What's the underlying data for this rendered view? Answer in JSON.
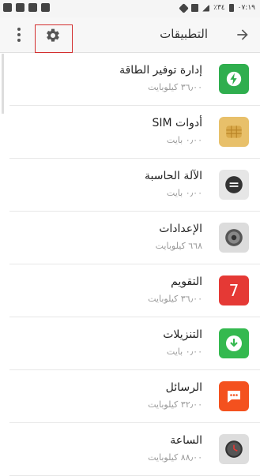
{
  "status_bar": {
    "battery": "٪٣٤",
    "time": "٠٧:١٩"
  },
  "toolbar": {
    "title": "التطبيقات",
    "menu_icon": "more-vert-icon",
    "settings_icon": "gear-icon",
    "back_icon": "arrow-right-icon"
  },
  "apps": [
    {
      "name": "إدارة توفير الطاقة",
      "size": "٣٦٫٠٠ كيلوبايت",
      "icon": "power-saver-icon",
      "color": "#2fae4e"
    },
    {
      "name": "أدوات SIM",
      "size": "٠٫٠٠ بايت",
      "icon": "sim-card-icon",
      "color": "#e8c06a"
    },
    {
      "name": "الآلة الحاسبة",
      "size": "٠٫٠٠ بايت",
      "icon": "calculator-icon",
      "color": "#e6e6e6"
    },
    {
      "name": "الإعدادات",
      "size": "٦٦٨ كيلوبايت",
      "icon": "settings-gear-icon",
      "color": "#dcdcdc"
    },
    {
      "name": "التقويم",
      "size": "٣٦٫٠٠ كيلوبايت",
      "icon": "calendar-icon",
      "color": "#e53935",
      "icon_text": "7"
    },
    {
      "name": "التنزيلات",
      "size": "٠٫٠٠ بايت",
      "icon": "download-icon",
      "color": "#34b94f"
    },
    {
      "name": "الرسائل",
      "size": "٣٢٫٠٠ كيلوبايت",
      "icon": "messages-icon",
      "color": "#f4511e"
    },
    {
      "name": "الساعة",
      "size": "٨٨٫٠٠ كيلوبايت",
      "icon": "clock-icon",
      "color": "#dddddd"
    }
  ]
}
